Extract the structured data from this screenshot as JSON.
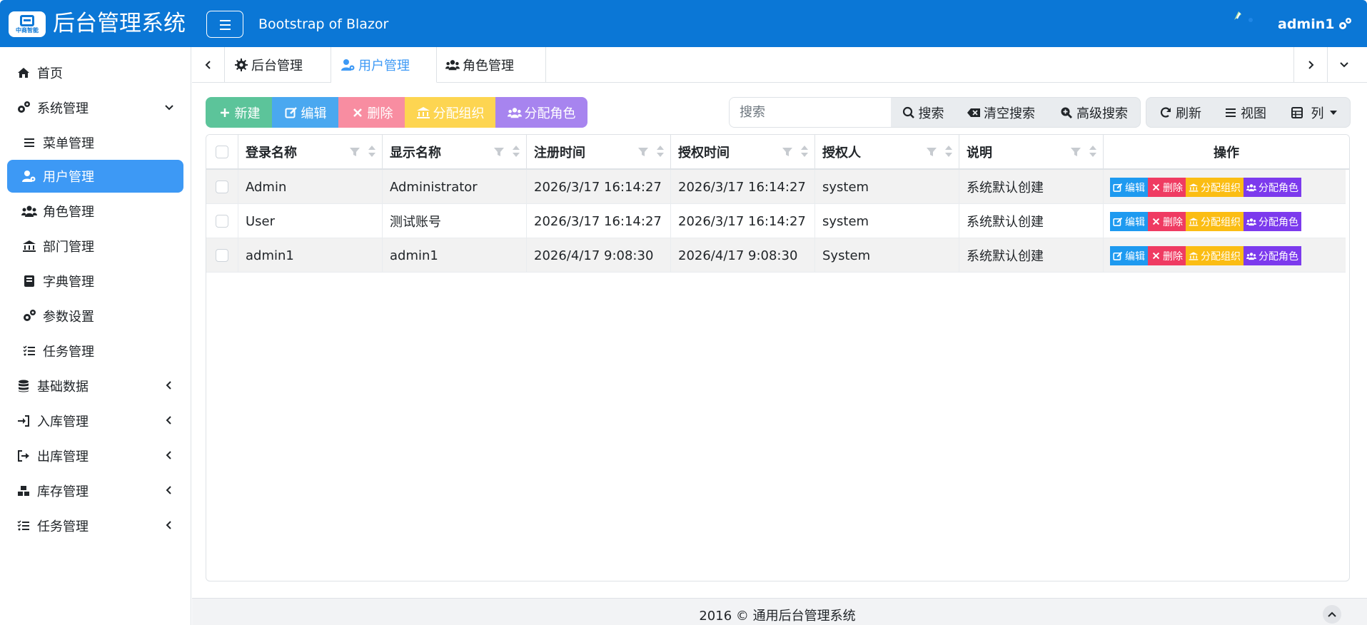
{
  "header": {
    "logo_text": "中商智能",
    "title": "后台管理系统",
    "subtitle": "Bootstrap of Blazor",
    "user_name": "admin1"
  },
  "sidebar": {
    "items": [
      {
        "label": "首页",
        "icon": "home-icon"
      },
      {
        "label": "系统管理",
        "icon": "cogs-icon",
        "expanded": true
      },
      {
        "label": "菜单管理",
        "icon": "bars-icon"
      },
      {
        "label": "用户管理",
        "icon": "user-cog-icon",
        "active": true
      },
      {
        "label": "角色管理",
        "icon": "users-icon"
      },
      {
        "label": "部门管理",
        "icon": "bank-icon"
      },
      {
        "label": "字典管理",
        "icon": "book-icon"
      },
      {
        "label": "参数设置",
        "icon": "cogs-icon"
      },
      {
        "label": "任务管理",
        "icon": "tasks-icon"
      },
      {
        "label": "基础数据",
        "icon": "database-icon"
      },
      {
        "label": "入库管理",
        "icon": "sign-in-icon"
      },
      {
        "label": "出库管理",
        "icon": "sign-out-icon"
      },
      {
        "label": "库存管理",
        "icon": "cubes-icon"
      },
      {
        "label": "任务管理",
        "icon": "tasks-icon"
      }
    ]
  },
  "tabs": [
    {
      "label": "后台管理",
      "icon": "gear-icon"
    },
    {
      "label": "用户管理",
      "icon": "user-cog-icon",
      "active": true
    },
    {
      "label": "角色管理",
      "icon": "users-icon"
    }
  ],
  "toolbar": {
    "new": "新建",
    "edit": "编辑",
    "delete": "删除",
    "assign_org": "分配组织",
    "assign_role": "分配角色",
    "search_placeholder": "搜索",
    "search": "搜索",
    "clear_search": "清空搜索",
    "advanced_search": "高级搜索",
    "refresh": "刷新",
    "view": "视图",
    "columns": "列"
  },
  "table": {
    "columns": [
      "登录名称",
      "显示名称",
      "注册时间",
      "授权时间",
      "授权人",
      "说明",
      "操作"
    ],
    "rows": [
      {
        "login": "Admin",
        "display": "Administrator",
        "registered": "2026/3/17 16:14:27",
        "approved": "2026/3/17 16:14:27",
        "approver": "system",
        "desc": "系统默认创建"
      },
      {
        "login": "User",
        "display": "测试账号",
        "registered": "2026/3/17 16:14:27",
        "approved": "2026/3/17 16:14:27",
        "approver": "system",
        "desc": "系统默认创建"
      },
      {
        "login": "admin1",
        "display": "admin1",
        "registered": "2026/4/17 9:08:30",
        "approved": "2026/4/17 9:08:30",
        "approver": "System",
        "desc": "系统默认创建"
      }
    ],
    "row_actions": {
      "edit": "编辑",
      "delete": "删除",
      "assign_org": "分配组织",
      "assign_role": "分配角色"
    }
  },
  "footer": {
    "text": "2016 © 通用后台管理系统"
  },
  "colors": {
    "brand": "#0b77d6",
    "active": "#3d99f5",
    "success": "#5cc49a",
    "info": "#4aa8f0",
    "danger": "#f88da1",
    "warning": "#fdd551",
    "purple": "#a784ef",
    "op_info": "#1e9af0",
    "op_danger": "#ef3b62",
    "op_warning": "#fbbd13",
    "op_purple": "#7c3aed"
  }
}
